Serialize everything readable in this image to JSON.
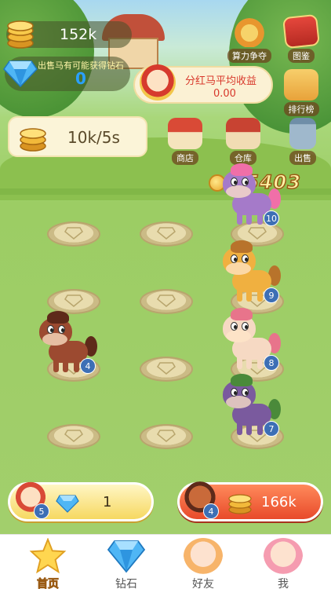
{
  "top": {
    "coins": "152k",
    "diamond_tip": "出售马有可能获得钻石",
    "diamonds": "0"
  },
  "dividend": {
    "title": "分红马平均收益",
    "value": "0.00"
  },
  "rate": "10k/5s",
  "buttons": {
    "suanli": "算力争夺",
    "tujian": "图鉴",
    "paihang": "排行榜",
    "shop": "商店",
    "store": "仓库",
    "sell": "出售"
  },
  "float_gain": "+5403",
  "horses": [
    {
      "level": "10",
      "color": "#a57ac9",
      "mane": "#f06fa8"
    },
    {
      "level": "9",
      "color": "#f0b040",
      "mane": "#b8732b"
    },
    {
      "level": "8",
      "color": "#f6d9c3",
      "mane": "#e8748b"
    },
    {
      "level": "7",
      "color": "#7a5a9e",
      "mane": "#4a8a3a"
    },
    {
      "level": "4",
      "color": "#9c4a30",
      "mane": "#5e2a1a"
    }
  ],
  "bottom": {
    "diamond_buy_level": "5",
    "diamond_buy_price": "1",
    "coin_buy_level": "4",
    "coin_buy_price": "166k"
  },
  "nav": {
    "home": "首页",
    "diamond": "钻石",
    "friends": "好友",
    "me": "我"
  },
  "colors": {
    "accent_red": "#e84a2a",
    "accent_yellow": "#f6d861",
    "diamond_blue": "#2aa0ff"
  }
}
